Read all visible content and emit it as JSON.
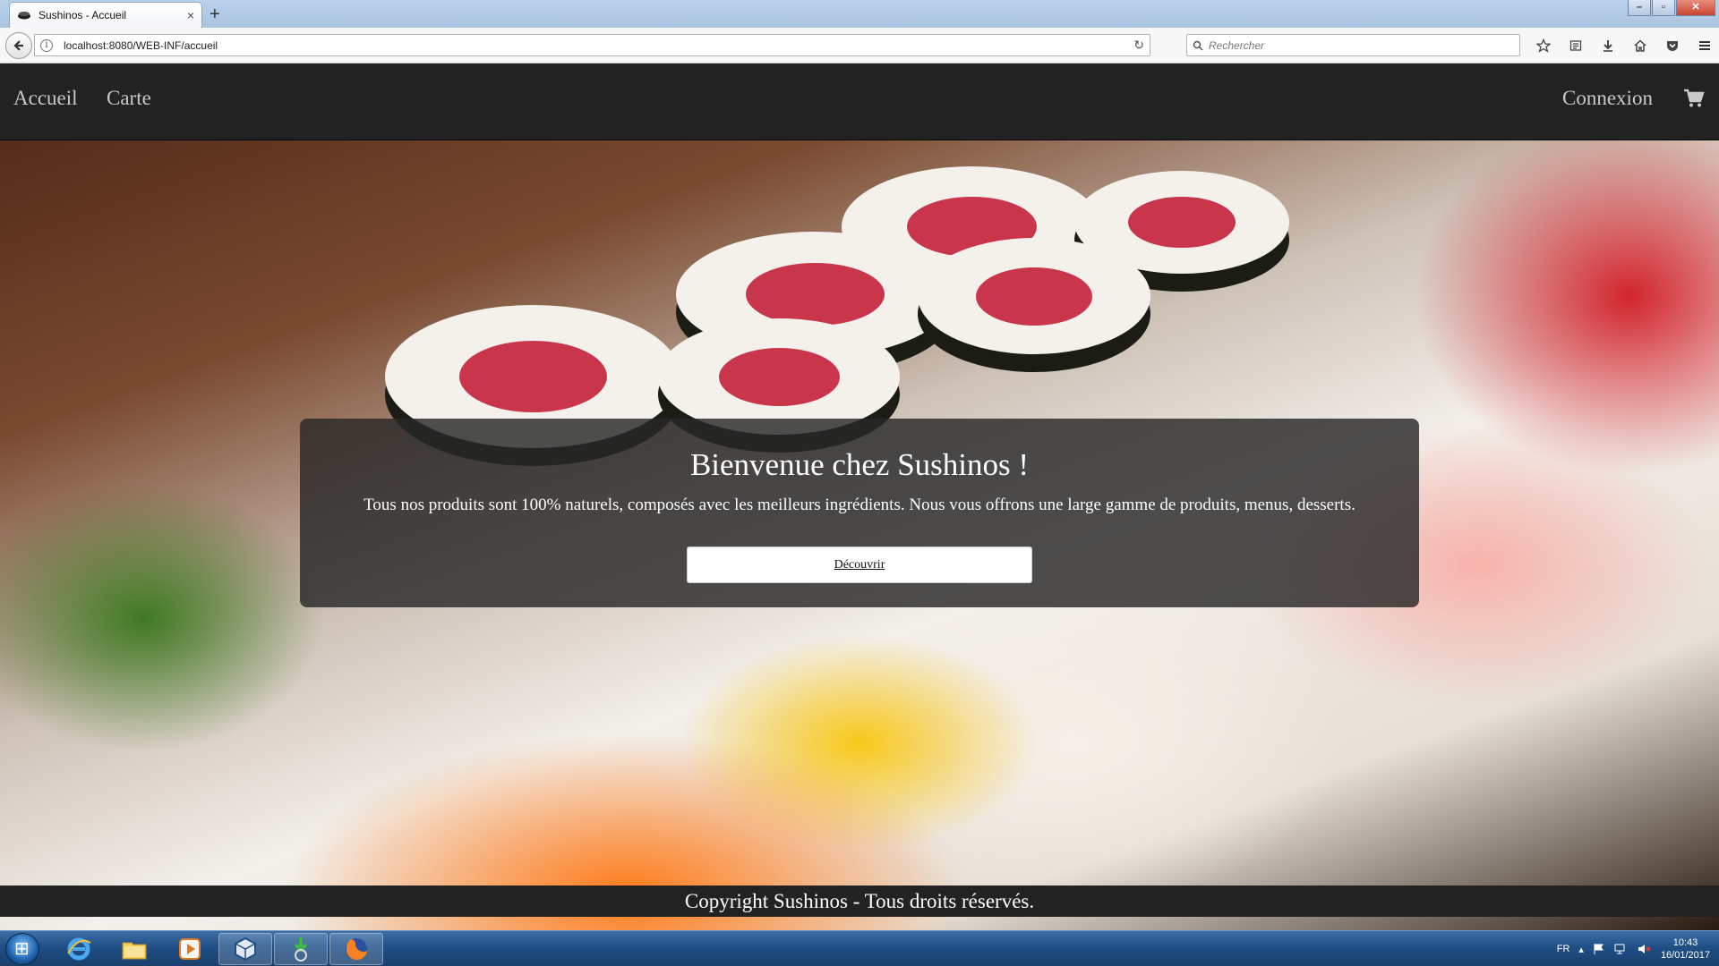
{
  "browser": {
    "tab_title": "Sushinos - Accueil",
    "tab_close": "×",
    "new_tab": "+",
    "url": "localhost:8080/WEB-INF/accueil",
    "search_placeholder": "Rechercher"
  },
  "nav": {
    "home_label": "Accueil",
    "menu_label": "Carte",
    "login_label": "Connexion"
  },
  "hero": {
    "title": "Bienvenue chez Sushinos !",
    "text": "Tous nos produits sont 100% naturels, composés avec les meilleurs ingrédients. Nous vous offrons une large gamme de produits, menus, desserts.",
    "button_label": "Découvrir"
  },
  "footer": {
    "text": "Copyright Sushinos - Tous droits réservés."
  },
  "taskbar": {
    "language": "FR",
    "time": "10:43",
    "date": "16/01/2017"
  },
  "colors": {
    "navbar_bg": "#222222",
    "nav_text": "#c9c9c9",
    "jumbotron_bg": "#282828"
  }
}
